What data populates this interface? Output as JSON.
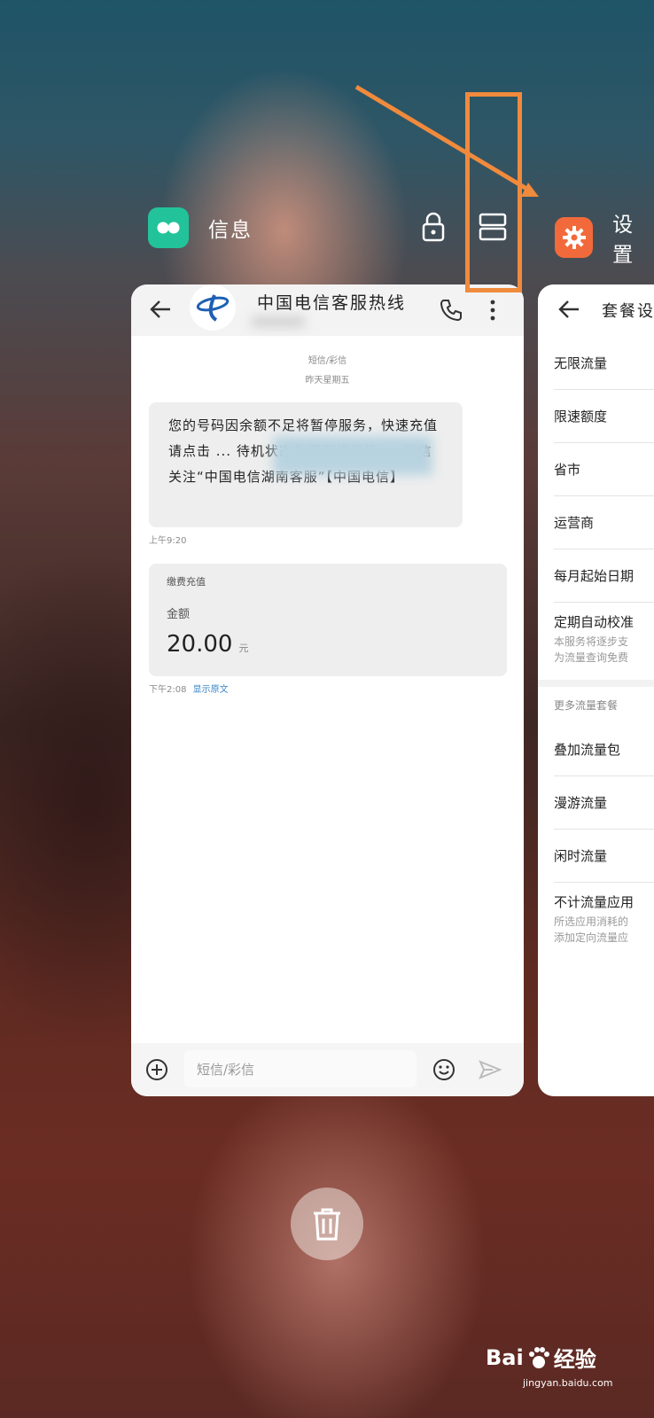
{
  "apps": {
    "messages": {
      "name": "信息",
      "icon": "messages-app-icon",
      "accent": "#22c39a"
    },
    "settings": {
      "name": "设置",
      "icon": "settings-gear-icon",
      "accent": "#f26a3b"
    }
  },
  "header_icons": [
    "lock-icon",
    "split-screen-icon"
  ],
  "messages_card": {
    "contact_name": "中国电信客服热线",
    "actions": [
      "back-arrow-icon",
      "phone-icon",
      "more-vertical-icon"
    ],
    "date_header_line1": "短信/彩信",
    "date_header_line2": "昨天星期五",
    "msg1_text": "您的号码因余额不足将暂停服务，快速充值请点击 ... 待机状态数据网络连接 ... 微信关注“中国电信湖南客服”【中国电信】",
    "msg1_time": "上午9:20",
    "msg2_title": "缴费充值",
    "msg2_label": "金额",
    "msg2_amount": "20.00",
    "msg2_unit": "元",
    "msg2_time": "下午2:08",
    "msg2_link": "显示原文",
    "input_placeholder": "短信/彩信"
  },
  "settings_card": {
    "title": "套餐设",
    "items": [
      "无限流量",
      "限速额度",
      "省市",
      "运营商",
      "每月起始日期",
      "定期自动校准"
    ],
    "item_desc": [
      "本服务将逐步支",
      "为流量查询免费"
    ],
    "section_header": "更多流量套餐",
    "items2": [
      "叠加流量包",
      "漫游流量",
      "闲时流量",
      "不计流量应用"
    ],
    "item2_desc": [
      "所选应用消耗的",
      "添加定向流量应"
    ]
  },
  "trash_button": "trash-icon",
  "watermark": {
    "brand": "Bai",
    "brand2": "经验",
    "url": "jingyan.baidu.com"
  },
  "colors": {
    "annotation_orange": "#f08a3c",
    "link_blue": "#3b88c8"
  }
}
